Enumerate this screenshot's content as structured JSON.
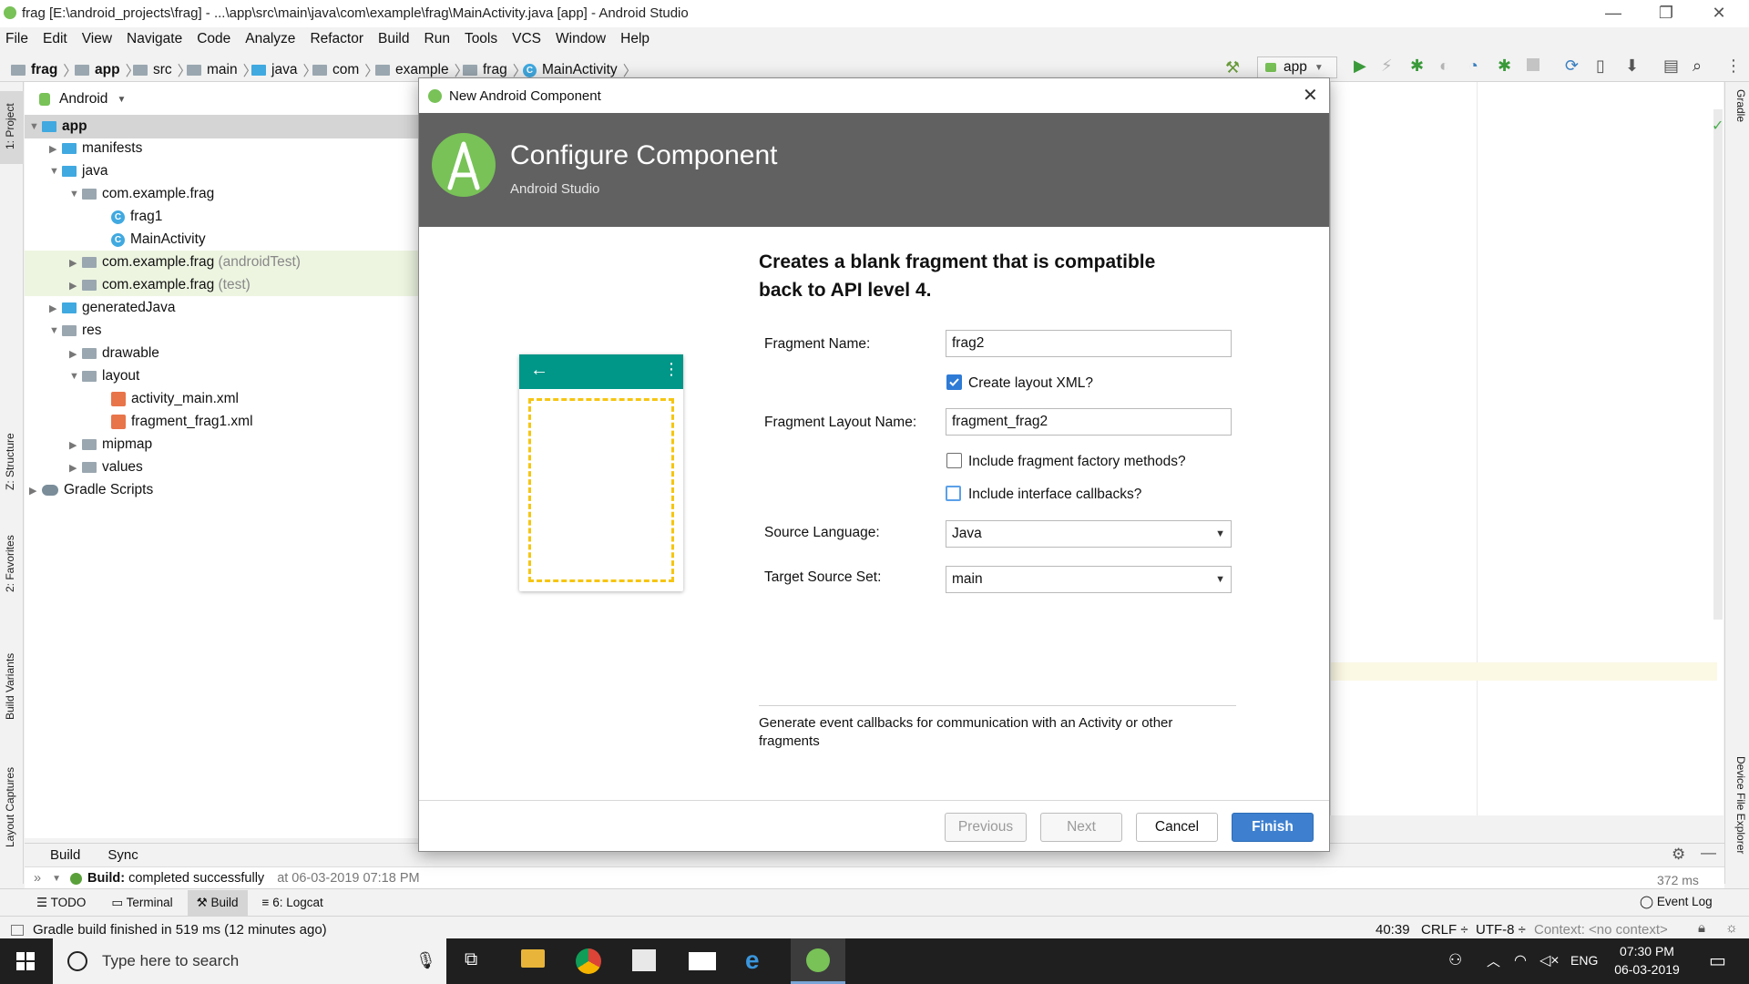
{
  "window": {
    "title": "frag [E:\\android_projects\\frag] - ...\\app\\src\\main\\java\\com\\example\\frag\\MainActivity.java [app] - Android Studio"
  },
  "menu": [
    "File",
    "Edit",
    "View",
    "Navigate",
    "Code",
    "Analyze",
    "Refactor",
    "Build",
    "Run",
    "Tools",
    "VCS",
    "Window",
    "Help"
  ],
  "breadcrumb": [
    "frag",
    "app",
    "src",
    "main",
    "java",
    "com",
    "example",
    "frag",
    "MainActivity"
  ],
  "run_config": "app",
  "left_tabs": [
    "1: Project",
    "Z: Structure",
    "2: Favorites",
    "Build Variants",
    "Layout Captures"
  ],
  "right_tabs": [
    "Gradle",
    "Device File Explorer"
  ],
  "project": {
    "view_mode": "Android",
    "tree": [
      {
        "label": "app",
        "extra": ""
      },
      {
        "label": "manifests",
        "extra": ""
      },
      {
        "label": "java",
        "extra": ""
      },
      {
        "label": "com.example.frag",
        "extra": ""
      },
      {
        "label": "frag1",
        "extra": ""
      },
      {
        "label": "MainActivity",
        "extra": ""
      },
      {
        "label": "com.example.frag",
        "extra": "(androidTest)"
      },
      {
        "label": "com.example.frag",
        "extra": "(test)"
      },
      {
        "label": "generatedJava",
        "extra": ""
      },
      {
        "label": "res",
        "extra": ""
      },
      {
        "label": "drawable",
        "extra": ""
      },
      {
        "label": "layout",
        "extra": ""
      },
      {
        "label": "activity_main.xml",
        "extra": ""
      },
      {
        "label": "fragment_frag1.xml",
        "extra": ""
      },
      {
        "label": "mipmap",
        "extra": ""
      },
      {
        "label": "values",
        "extra": ""
      },
      {
        "label": "Gradle Scripts",
        "extra": ""
      }
    ]
  },
  "build_panel": {
    "tabs": [
      "Build",
      "Sync"
    ],
    "result_label": "Build:",
    "result_text": "completed successfully",
    "result_time": "at 06-03-2019 07:18 PM",
    "duration": "372 ms"
  },
  "bottom_tabs": [
    "TODO",
    "Terminal",
    "Build",
    "6: Logcat"
  ],
  "event_log": "Event Log",
  "status": {
    "message": "Gradle build finished in 519 ms (12 minutes ago)",
    "position": "40:39",
    "line_sep": "CRLF ÷",
    "encoding": "UTF-8 ÷",
    "context": "Context: <no context>"
  },
  "dialog": {
    "title": "New Android Component",
    "banner_title": "Configure Component",
    "banner_subtitle": "Android Studio",
    "heading": "Creates a blank fragment that is compatible back to API level 4.",
    "fields": {
      "fragment_name_label": "Fragment Name:",
      "fragment_name_value": "frag2",
      "create_layout_label": "Create layout XML?",
      "create_layout_checked": true,
      "layout_name_label": "Fragment Layout Name:",
      "layout_name_value": "fragment_frag2",
      "factory_label": "Include fragment factory methods?",
      "factory_checked": false,
      "callbacks_label": "Include interface callbacks?",
      "callbacks_checked": false,
      "source_language_label": "Source Language:",
      "source_language_value": "Java",
      "target_set_label": "Target Source Set:",
      "target_set_value": "main"
    },
    "help_text": "Generate event callbacks for communication with an Activity or other fragments",
    "buttons": {
      "previous": "Previous",
      "next": "Next",
      "cancel": "Cancel",
      "finish": "Finish"
    }
  },
  "taskbar": {
    "search_placeholder": "Type here to search",
    "language": "ENG",
    "time": "07:30 PM",
    "date": "06-03-2019"
  },
  "colors": {
    "android_green": "#78c257",
    "banner": "#616161",
    "primary_button": "#3e80cf",
    "phone_teal": "#009688",
    "fragment_dash": "#f6c511"
  }
}
